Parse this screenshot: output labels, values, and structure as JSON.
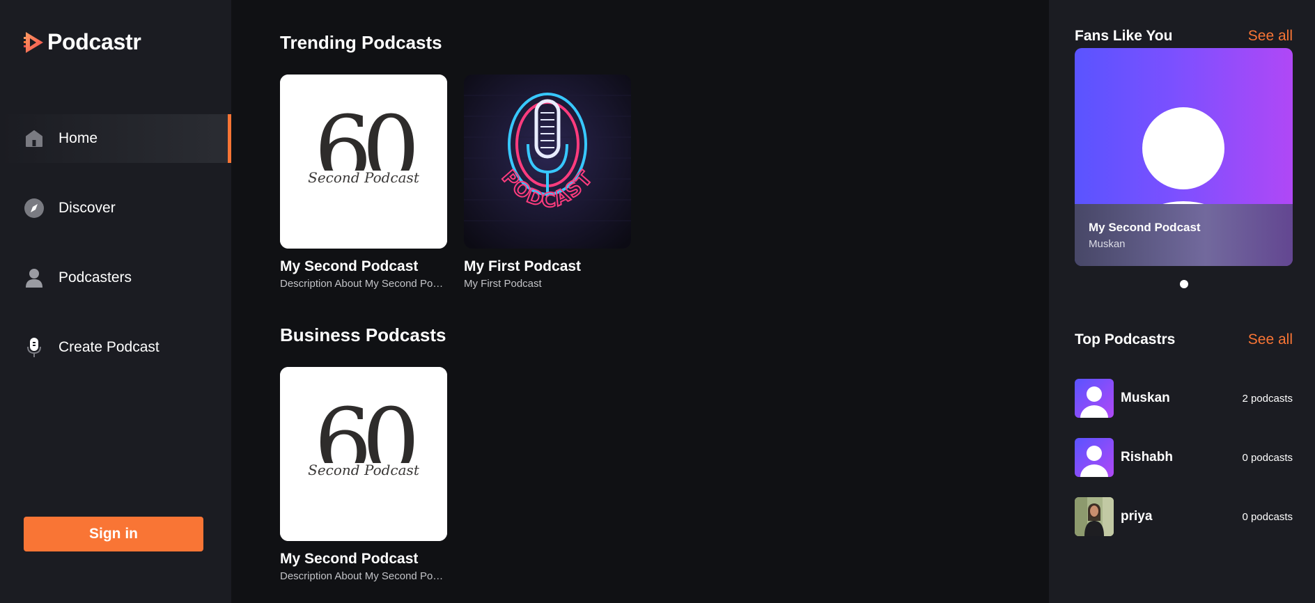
{
  "brand": {
    "name": "Podcastr",
    "accent": "#f97535"
  },
  "sidebar": {
    "items": [
      {
        "label": "Home",
        "icon": "home-icon",
        "active": true
      },
      {
        "label": "Discover",
        "icon": "compass-icon",
        "active": false
      },
      {
        "label": "Podcasters",
        "icon": "user-icon",
        "active": false
      },
      {
        "label": "Create Podcast",
        "icon": "microphone-icon",
        "active": false
      }
    ],
    "signin_label": "Sign in"
  },
  "main": {
    "trending": {
      "title": "Trending Podcasts",
      "cards": [
        {
          "title": "My Second Podcast",
          "description": "Description About My Second Podcast",
          "cover": "60-second-podcast-logo",
          "cover_big": "60",
          "cover_script": "Second Podcast"
        },
        {
          "title": "My First Podcast",
          "description": "My First Podcast",
          "cover": "neon-podcast-microphone",
          "cover_word": "PODCAST"
        }
      ]
    },
    "business": {
      "title": "Business Podcasts",
      "cards": [
        {
          "title": "My Second Podcast",
          "description": "Description About My Second Podcast",
          "cover": "60-second-podcast-logo",
          "cover_big": "60",
          "cover_script": "Second Podcast"
        }
      ]
    }
  },
  "rightbar": {
    "fans": {
      "title": "Fans Like You",
      "see_all": "See all",
      "slide": {
        "title": "My Second Podcast",
        "author": "Muskan"
      },
      "slide_count": 1
    },
    "top": {
      "title": "Top Podcastrs",
      "see_all": "See all",
      "items": [
        {
          "name": "Muskan",
          "count": "2 podcasts",
          "avatar": "default-avatar"
        },
        {
          "name": "Rishabh",
          "count": "0 podcasts",
          "avatar": "default-avatar"
        },
        {
          "name": "priya",
          "count": "0 podcasts",
          "avatar": "photo-avatar"
        }
      ]
    }
  }
}
